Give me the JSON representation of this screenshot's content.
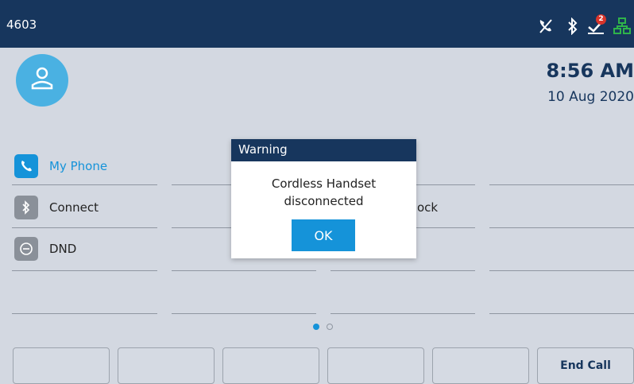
{
  "status_bar": {
    "extension": "4603",
    "icons": [
      "call-forward-icon",
      "bluetooth-icon",
      "voicemail-icon",
      "network-icon"
    ],
    "voicemail_badge": "2"
  },
  "clock": {
    "time": "8:56 AM",
    "date": "10 Aug 2020"
  },
  "line_keys": [
    {
      "label": "My Phone",
      "icon": "phone-icon",
      "icon_bg": "#1593d9",
      "color": "#1593d9"
    },
    {
      "label": "Connect",
      "icon": "bluetooth-icon",
      "icon_bg": "#8a9099",
      "color": "#222222"
    },
    {
      "label": "DND",
      "icon": "dnd-icon",
      "icon_bg": "#8a9099",
      "color": "#222222"
    }
  ],
  "partial_key_label": "ock",
  "dialog": {
    "title": "Warning",
    "message_line1": "Cordless Handset",
    "message_line2": "disconnected",
    "ok_label": "OK"
  },
  "pagination": {
    "current": 1,
    "total": 2
  },
  "softkeys": [
    "",
    "",
    "",
    "",
    "",
    "End Call"
  ],
  "colors": {
    "header": "#17365d",
    "accent": "#1593d9",
    "background": "#d3d8e1",
    "network_icon": "#2fb34a",
    "badge": "#d9352b"
  }
}
